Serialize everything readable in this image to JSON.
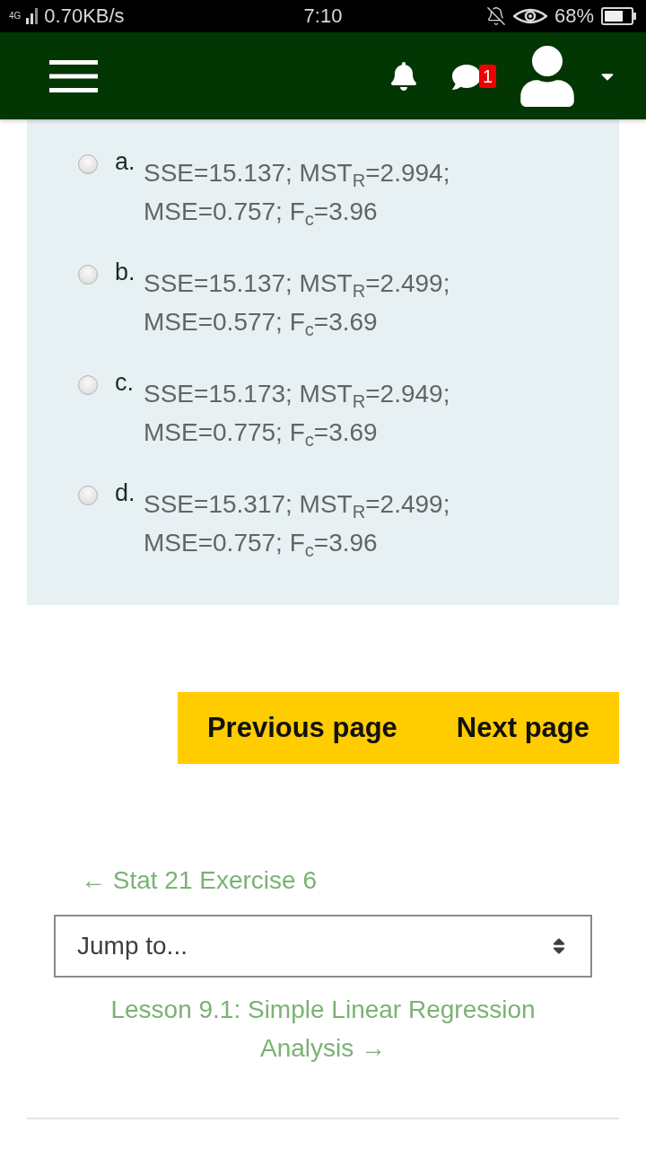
{
  "status_bar": {
    "network": "4G",
    "speed": "0.70KB/s",
    "time": "7:10",
    "battery": "68%"
  },
  "navbar": {
    "messages_badge": "1"
  },
  "options": [
    {
      "label": "a.",
      "text": "SSE=15.137; MST$_{R}$=2.994; MSE=0.757; F$_{c}$=3.96",
      "selected": false
    },
    {
      "label": "b.",
      "text": "SSE=15.137; MST$_{R}$=2.499; MSE=0.577; F$_{c}$=3.69",
      "selected": false
    },
    {
      "label": "c.",
      "text": "SSE=15.173; MST$_{R}$=2.949; MSE=0.775; F$_{c}$=3.69",
      "selected": false
    },
    {
      "label": "d.",
      "text": "SSE=15.317; MST$_{R}$=2.499; MSE=0.757; F$_{c}$=3.96",
      "selected": false
    }
  ],
  "buttons": [
    {
      "label": "Previous page"
    },
    {
      "label": "Next page"
    }
  ],
  "previous_activity": "← Stat 21 Exercise 6",
  "jump_select": {
    "value": "Jump to..."
  },
  "next_activity": "Lesson 9.1: Simple Linear Regression Analysis →"
}
